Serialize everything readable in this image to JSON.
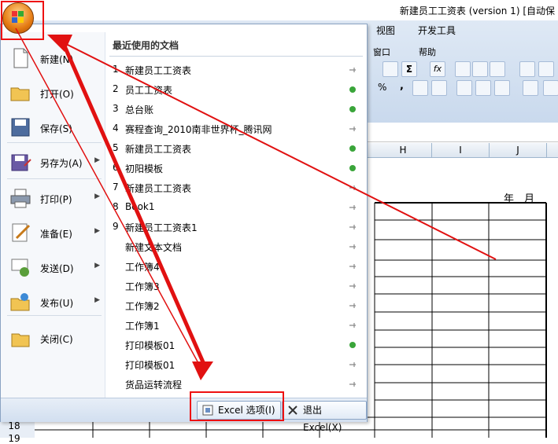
{
  "window": {
    "title": "新建员工工资表 (version 1) [自动保"
  },
  "ribbon": {
    "tabs": [
      "视图",
      "开发工具"
    ],
    "row2": [
      "窗口",
      "帮助"
    ],
    "row3": [
      "%",
      ","
    ]
  },
  "columns": [
    "H",
    "I",
    "J"
  ],
  "sheet": {
    "header_text": "年　月"
  },
  "rows": [
    "18",
    "19"
  ],
  "menu": {
    "left_items": [
      {
        "label": "新建(N)",
        "icon": "new-file-icon",
        "arrow": false
      },
      {
        "label": "打开(O)",
        "icon": "open-folder-icon",
        "arrow": false
      },
      {
        "label": "保存(S)",
        "icon": "save-disk-icon",
        "arrow": false
      },
      {
        "label": "另存为(A)",
        "icon": "save-as-icon",
        "arrow": true
      },
      {
        "label": "打印(P)",
        "icon": "printer-icon",
        "arrow": true
      },
      {
        "label": "准备(E)",
        "icon": "prepare-pen-icon",
        "arrow": true
      },
      {
        "label": "发送(D)",
        "icon": "send-icon",
        "arrow": true
      },
      {
        "label": "发布(U)",
        "icon": "publish-icon",
        "arrow": true
      },
      {
        "label": "关闭(C)",
        "icon": "close-folder-icon",
        "arrow": false
      }
    ],
    "recent_title": "最近使用的文档",
    "recent": [
      {
        "num": "1",
        "name": "新建员工工资表",
        "pinned": false
      },
      {
        "num": "2",
        "name": "员工工资表",
        "pinned": true
      },
      {
        "num": "3",
        "name": "总台账",
        "pinned": true
      },
      {
        "num": "4",
        "name": "赛程查询_2010南非世界杯_腾讯网",
        "pinned": false
      },
      {
        "num": "5",
        "name": "新建员工工资表",
        "pinned": true
      },
      {
        "num": "6",
        "name": "初阳模板",
        "pinned": true
      },
      {
        "num": "7",
        "name": "新建员工工资表",
        "pinned": false
      },
      {
        "num": "8",
        "name": "Book1",
        "pinned": false
      },
      {
        "num": "9",
        "name": "新建员工工资表1",
        "pinned": false
      },
      {
        "num": "",
        "name": "新建文本文档",
        "pinned": false
      },
      {
        "num": "",
        "name": "工作簿4",
        "pinned": false
      },
      {
        "num": "",
        "name": "工作簿3",
        "pinned": false
      },
      {
        "num": "",
        "name": "工作簿2",
        "pinned": false
      },
      {
        "num": "",
        "name": "工作簿1",
        "pinned": false
      },
      {
        "num": "",
        "name": "打印模板01",
        "pinned": true
      },
      {
        "num": "",
        "name": "打印模板01",
        "pinned": false
      },
      {
        "num": "",
        "name": "货品运转流程",
        "pinned": false
      }
    ],
    "options_label": "Excel 选项(I)",
    "exit_label": "退出 Excel(X)"
  },
  "colors": {
    "annotation": "#e11111",
    "pinned": "#3aa53a",
    "ribbon": "#d6e3f3"
  }
}
